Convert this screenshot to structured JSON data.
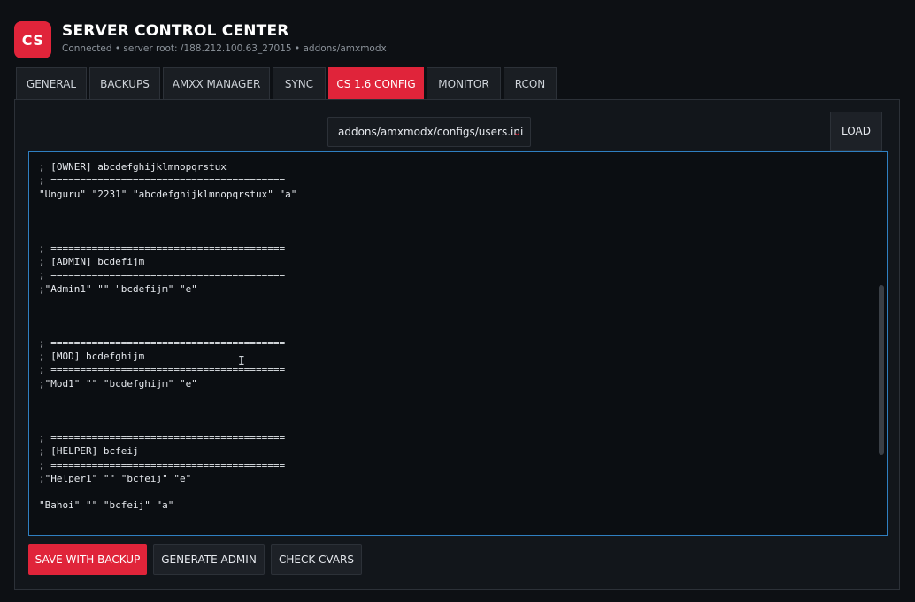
{
  "app": {
    "logo": "CS",
    "title": "SERVER CONTROL CENTER",
    "subtitle": "Connected • server root: /188.212.100.63_27015 • addons/amxmodx"
  },
  "tabs": [
    {
      "label": "GENERAL"
    },
    {
      "label": "BACKUPS"
    },
    {
      "label": "AMXX MANAGER"
    },
    {
      "label": "SYNC"
    },
    {
      "label": "CS 1.6 CONFIG",
      "active": true
    },
    {
      "label": "MONITOR"
    },
    {
      "label": "RCON"
    }
  ],
  "file_select": {
    "value": "addons/amxmodx/configs/users.ini",
    "chevron_icon": "chevron-down-icon"
  },
  "load_label": "LOAD",
  "editor": {
    "content": "; [OWNER] abcdefghijklmnopqrstux\n; ========================================\n\"Unguru\" \"2231\" \"abcdefghijklmnopqrstux\" \"a\"\n\n\n\n; ========================================\n; [ADMIN] bcdefijm\n; ========================================\n;\"Admin1\" \"\" \"bcdefijm\" \"e\"\n\n\n\n; ========================================\n; [MOD] bcdefghijm\n; ========================================\n;\"Mod1\" \"\" \"bcdefghijm\" \"e\"\n\n\n\n; ========================================\n; [HELPER] bcfeij\n; ========================================\n;\"Helper1\" \"\" \"bcfeij\" \"e\"\n\n\"Bahoi\" \"\" \"bcfeij\" \"a\""
  },
  "actions": {
    "save": "SAVE WITH BACKUP",
    "generate": "GENERATE ADMIN",
    "check": "CHECK CVARS"
  },
  "colors": {
    "accent": "#e0243a",
    "focus_border": "#2f7fc1",
    "background": "#0d1014"
  }
}
